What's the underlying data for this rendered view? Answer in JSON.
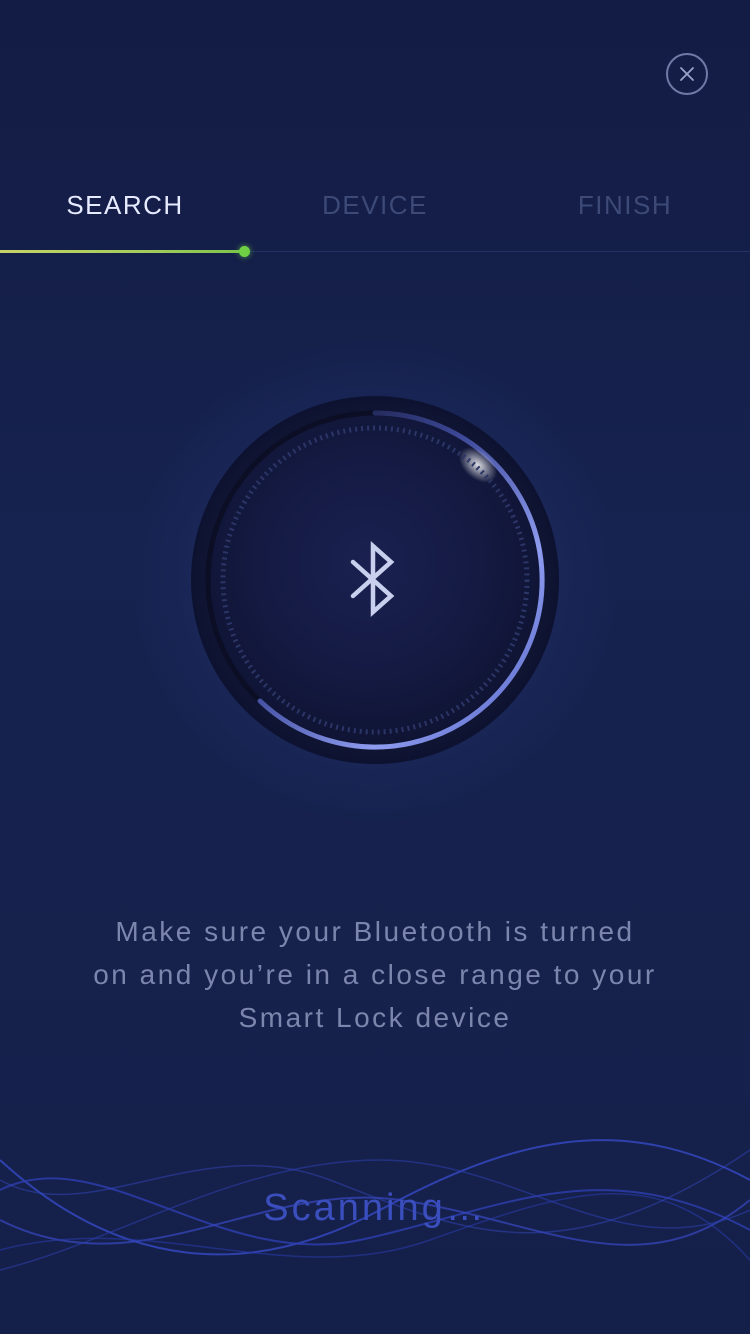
{
  "close": {
    "icon": "close-icon"
  },
  "steps": [
    {
      "label": "SEARCH",
      "active": true
    },
    {
      "label": "DEVICE",
      "active": false
    },
    {
      "label": "FINISH",
      "active": false
    }
  ],
  "progress": {
    "fraction": 0.325
  },
  "dial": {
    "icon": "bluetooth-icon"
  },
  "message": {
    "line1": "Make sure your Bluetooth is turned",
    "line2": "on and you’re in a close range to your",
    "line3": "Smart Lock device"
  },
  "status": {
    "text": "Scanning…"
  },
  "colors": {
    "background": "#15204a",
    "accent_active_text": "#e6ebff",
    "inactive_text": "#3d4977",
    "progress_start": "#c5d36a",
    "progress_end": "#6fd046",
    "dial_ring": "#8e9cf0",
    "scanning_text": "#3b4ebd"
  }
}
